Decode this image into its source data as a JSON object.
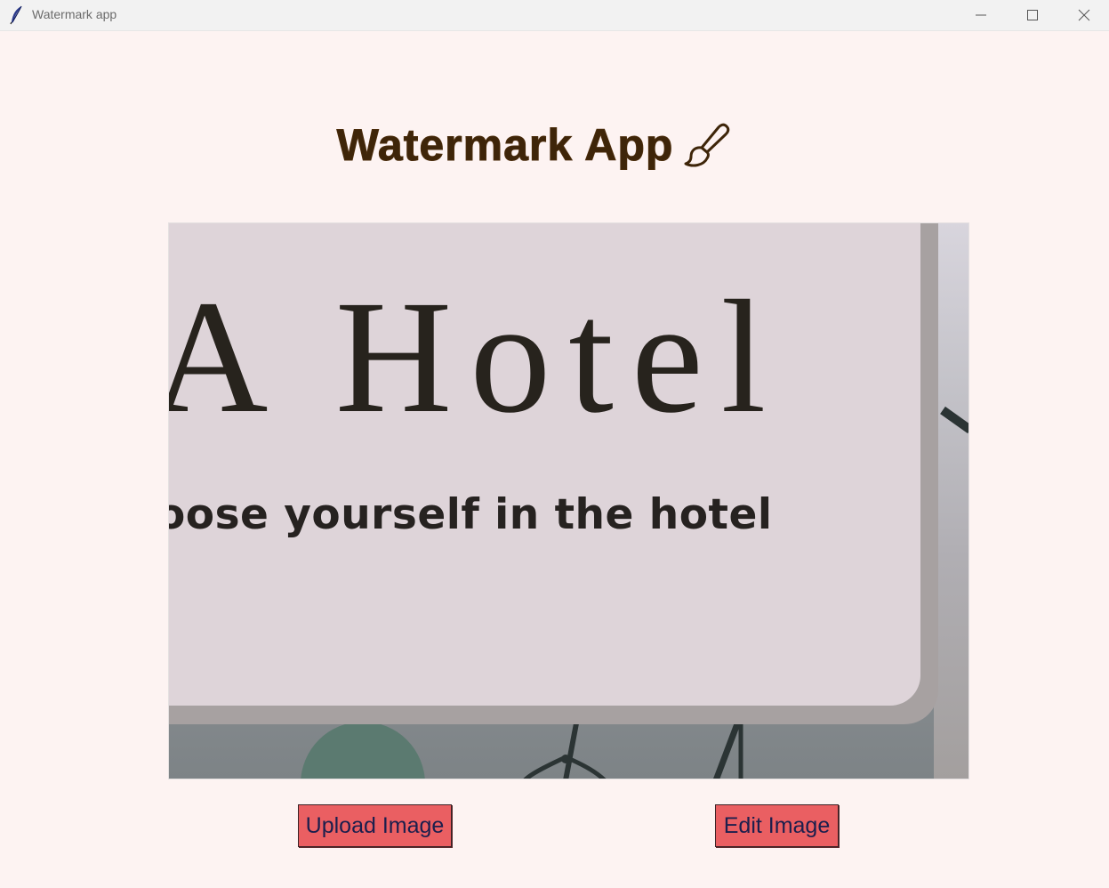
{
  "window": {
    "title": "Watermark app",
    "icon": "feather-icon",
    "controls": [
      "minimize-icon",
      "maximize-icon",
      "close-icon"
    ]
  },
  "header": {
    "title": "Watermark App",
    "icon": "paintbrush-icon",
    "title_color": "#3e2509"
  },
  "preview": {
    "headline": "A Hotel",
    "tagline": "oose yourself in the hotel"
  },
  "buttons": {
    "upload_label": "Upload Image",
    "edit_label": "Edit Image",
    "color": "#ea5f62",
    "text_color": "#1c1f4d"
  },
  "colors": {
    "background": "#fdf3f2"
  }
}
